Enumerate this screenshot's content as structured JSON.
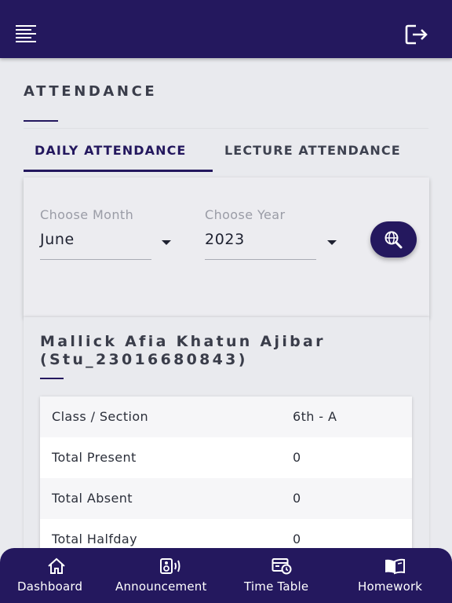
{
  "header": {
    "menu_icon": "menu-lines-icon",
    "logout_icon": "logout-icon"
  },
  "page": {
    "title": "ATTENDANCE"
  },
  "tabs": [
    {
      "label": "DAILY ATTENDANCE",
      "active": true
    },
    {
      "label": "LECTURE ATTENDANCE",
      "active": false
    }
  ],
  "filters": {
    "month_label": "Choose Month",
    "month_value": "June",
    "year_label": "Choose Year",
    "year_value": "2023",
    "search_icon": "globe-search-icon"
  },
  "student": {
    "name": "Mallick Afia Khatun Ajibar",
    "id_line": "(Stu_23016680843)"
  },
  "stats": [
    {
      "key": "Class / Section",
      "value": "6th - A"
    },
    {
      "key": "Total Present",
      "value": "0"
    },
    {
      "key": "Total Absent",
      "value": "0"
    },
    {
      "key": "Total Halfday",
      "value": "0"
    }
  ],
  "bottom_nav": [
    {
      "label": "Dashboard",
      "icon": "home-icon"
    },
    {
      "label": "Announcement",
      "icon": "announcement-icon"
    },
    {
      "label": "Time Table",
      "icon": "timetable-icon"
    },
    {
      "label": "Homework",
      "icon": "book-icon"
    }
  ],
  "colors": {
    "primary": "#24185e",
    "background": "#e9eaee",
    "card": "#ececf0",
    "text": "#2b2f3a"
  }
}
